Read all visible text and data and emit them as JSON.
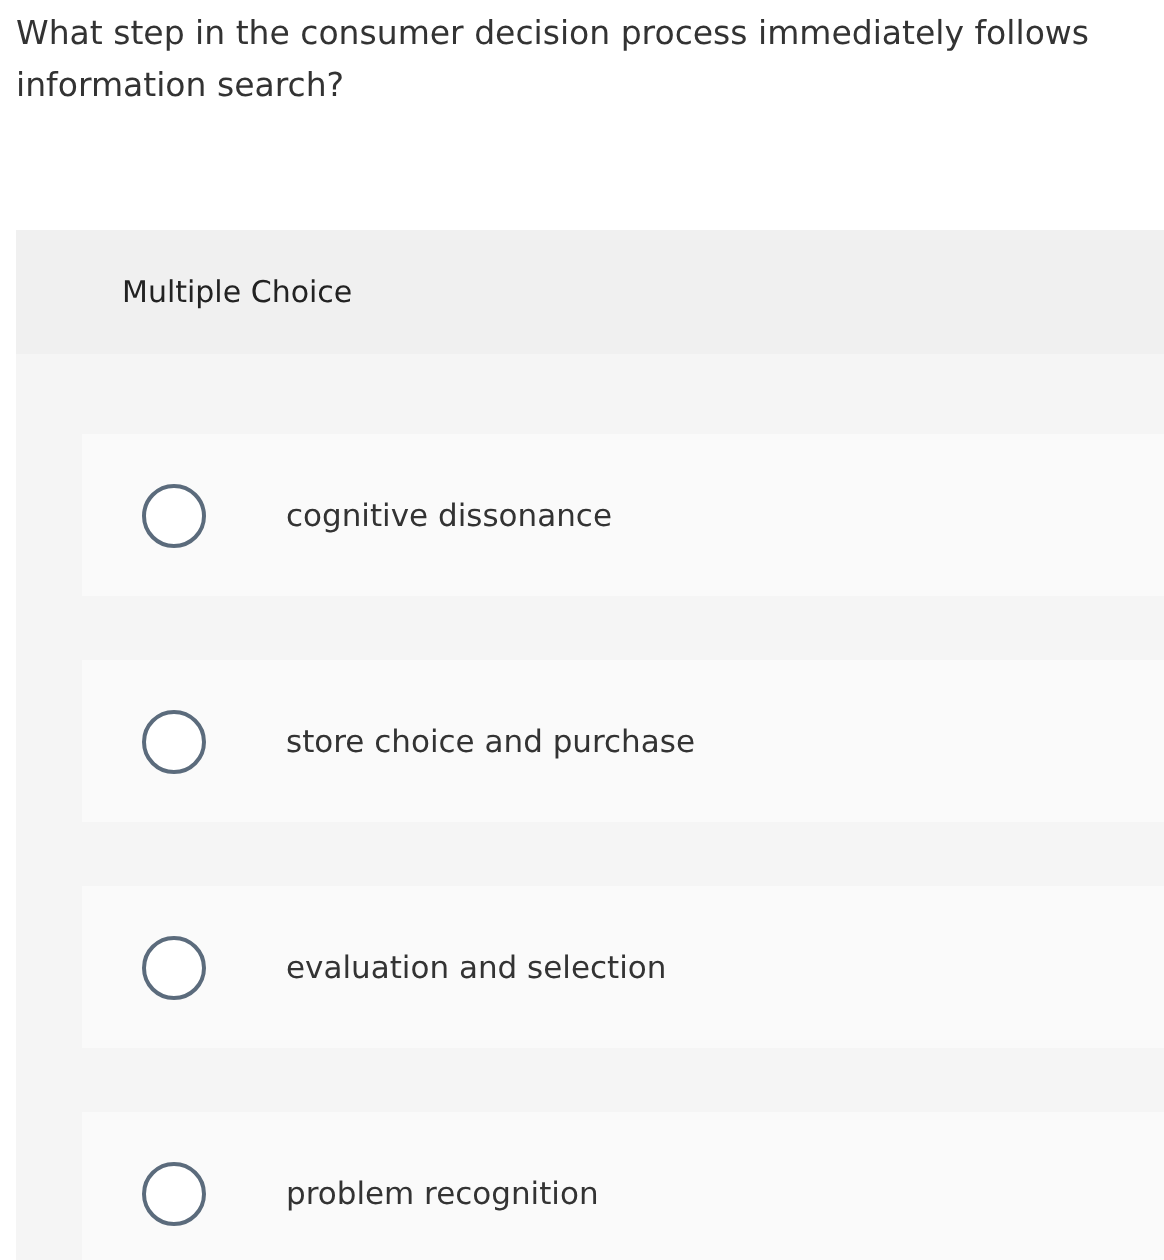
{
  "question": "What step in the consumer decision process immediately follows information search?",
  "panel": {
    "title": "Multiple Choice",
    "options": [
      {
        "label": "cognitive dissonance",
        "selected": false
      },
      {
        "label": "store choice and purchase",
        "selected": false
      },
      {
        "label": "evaluation and selection",
        "selected": false
      },
      {
        "label": "problem recognition",
        "selected": false
      }
    ]
  }
}
